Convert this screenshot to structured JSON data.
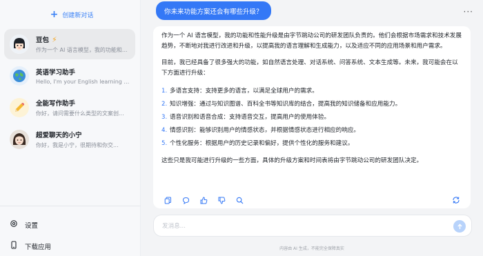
{
  "sidebar": {
    "new_chat_label": "创建新对话",
    "items": [
      {
        "title": "豆包",
        "subtitle": "作为一个 AI 语言模型，我的功能和..."
      },
      {
        "title": "英语学习助手",
        "subtitle": "Hello, I'm your English learning ass..."
      },
      {
        "title": "全能写作助手",
        "subtitle": "你好，请问需要什么类型的文案创..."
      },
      {
        "title": "超爱聊天的小宁",
        "subtitle": "你好，我是小宁，很期待和你交..."
      }
    ],
    "settings_label": "设置",
    "download_label": "下载应用"
  },
  "chat": {
    "user_message": "你未来功能方案还会有哪些升级？",
    "answer_paragraphs": [
      "作为一个 AI 语言模型，我的功能和性能升级是由字节跳动公司的研发团队负责的。他们会根据市场需求和技术发展趋势，不断地对我进行改进和升级，以提高我的语言理解和生成能力，以及适应不同的应用场景和用户需求。",
      "目前，我已经具备了很多强大的功能，如自然语言处理、对话系统、问答系统、文本生成等。未来，我可能会在以下方面进行升级："
    ],
    "answer_list": [
      {
        "num": "1.",
        "text": "多语言支持：支持更多的语言，以满足全球用户的需求。"
      },
      {
        "num": "2.",
        "text": "知识增强：通过与知识图谱、百科全书等知识库的结合，提高我的知识储备和应用能力。"
      },
      {
        "num": "3.",
        "text": "语音识别和语音合成：支持语音交互，提高用户的使用体验。"
      },
      {
        "num": "4.",
        "text": "情感识别：能够识别用户的情感状态，并根据情感状态进行相应的响应。"
      },
      {
        "num": "5.",
        "text": "个性化服务：根据用户的历史记录和偏好，提供个性化的服务和建议。"
      }
    ],
    "answer_closing": "这些只是我可能进行升级的一些方面，具体的升级方案和时间表将由字节跳动公司的研发团队决定。"
  },
  "input": {
    "placeholder": "发消息...",
    "value": ""
  },
  "disclaimer": "内容由 AI 生成，不能完全保障真实",
  "colors": {
    "accent": "#3478f6",
    "sidebar_bg": "#f7f8fa",
    "main_bg": "#f3f4f6"
  }
}
